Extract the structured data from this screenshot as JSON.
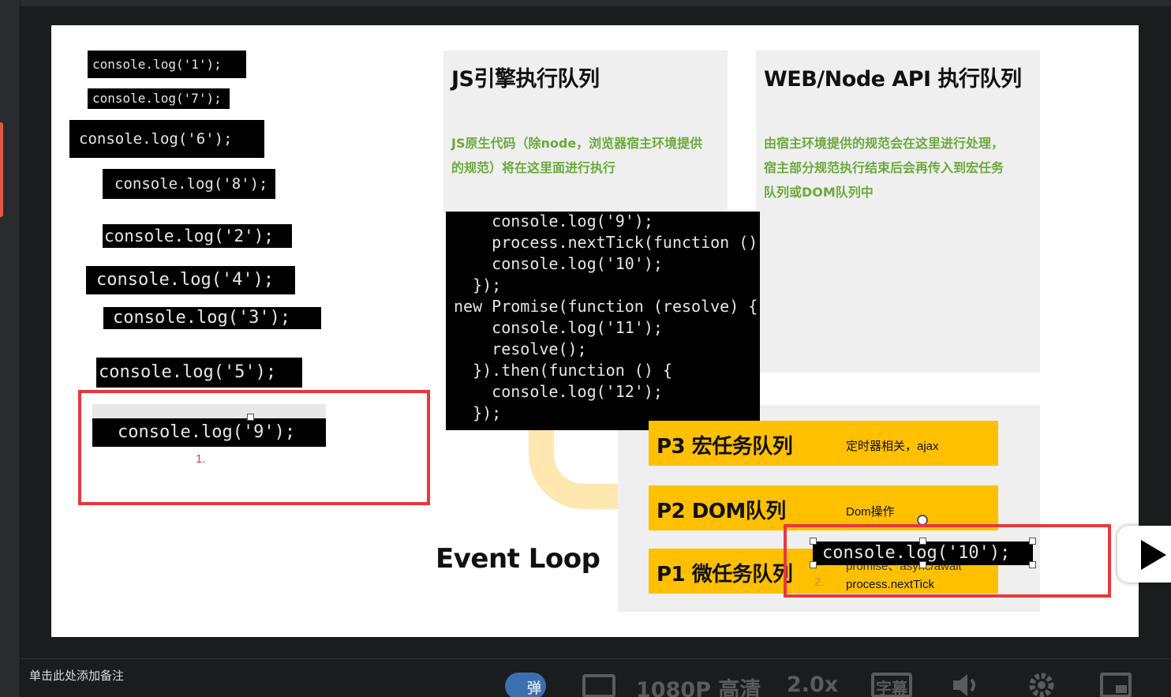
{
  "slide": {
    "snippets": [
      "console.log('1');",
      "console.log('7');",
      "console.log('6');",
      "console.log('8');",
      "console.log('2');",
      "console.log('4');",
      "console.log('3');",
      "console.log('5');",
      "console.log('9');",
      "console.log('10');"
    ],
    "js_panel": {
      "title": "JS引擎执行队列",
      "desc_line1": "JS原生代码（除node，浏览器宿主环境提供",
      "desc_line2": "的规范）将在这里面进行执行"
    },
    "api_panel": {
      "title": "WEB/Node API 执行队列",
      "desc_line1": "由宿主环境提供的规范会在这里进行处理，",
      "desc_line2": "宿主部分规范执行结束后会再传入到宏任务",
      "desc_line3": "队列或DOM队列中"
    },
    "code_lines": [
      "    console.log('9');",
      "    process.nextTick(function () {",
      "    console.log('10');",
      "  });",
      "new Promise(function (resolve) {",
      "    console.log('11');",
      "    resolve();",
      "  }).then(function () {",
      "    console.log('12');",
      "  });"
    ],
    "queues": {
      "p3_label": "P3 宏任务队列",
      "p3_note": "定时器相关，ajax",
      "p2_label": "P2 DOM队列",
      "p2_note": "Dom操作",
      "p1_label": "P1 微任务队列",
      "p1_note_a": "promise、async/await",
      "p1_note_b": "process.nextTick"
    },
    "event_loop": "Event Loop",
    "annotation_1": "1.",
    "annotation_2": "2."
  },
  "notes_placeholder": "单击此处添加备注",
  "controls": {
    "danmaku": "弹",
    "quality": "1080P 高清",
    "speed": "2.0x",
    "subtitle": "字幕"
  },
  "icons": [
    "settings-icon",
    "volume-icon",
    "picture-in-picture-icon",
    "play-icon",
    "quality-icon"
  ]
}
